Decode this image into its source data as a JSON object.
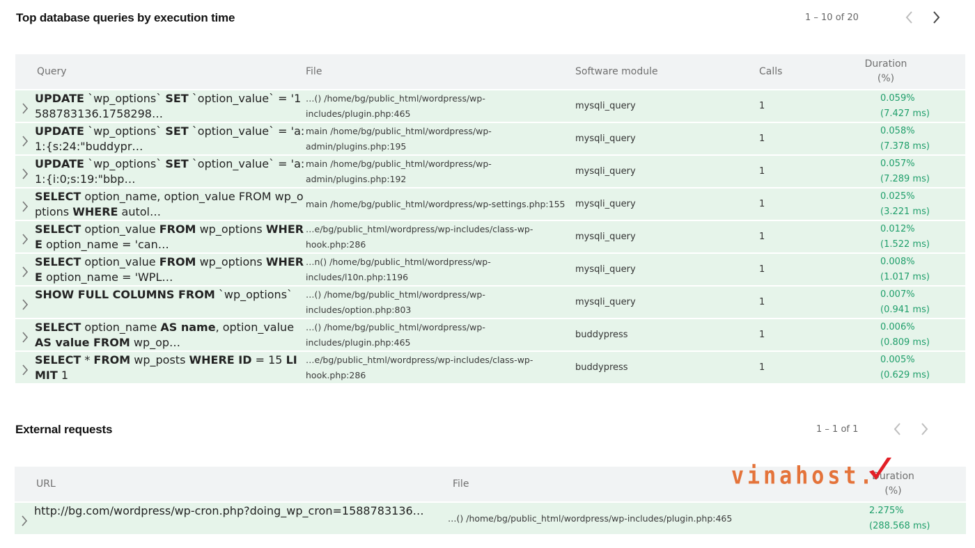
{
  "queries": {
    "title": "Top database queries by execution time",
    "pager": {
      "range": "1 – 10 of 20"
    },
    "columns": {
      "query": "Query",
      "file": "File",
      "module": "Software module",
      "calls": "Calls",
      "duration_1": "Duration",
      "duration_2": "(%)"
    },
    "rows": [
      {
        "query_html": "<b>UPDATE</b> `wp_options` <b>SET</b> `option_value` = '1588783136.1758298…",
        "file": "…() /home/bg/public_html/wordpress/wp-includes/plugin.php:465",
        "module": "mysqli_query",
        "calls": "1",
        "duration": "0.059% (7.427 ms)"
      },
      {
        "query_html": "<b>UPDATE</b> `wp_options` <b>SET</b> `option_value` = 'a:1:{s:24:\"buddypr…",
        "file": "main /home/bg/public_html/wordpress/wp-admin/plugins.php:195",
        "module": "mysqli_query",
        "calls": "1",
        "duration": "0.058% (7.378 ms)"
      },
      {
        "query_html": "<b>UPDATE</b> `wp_options` <b>SET</b> `option_value` = 'a:1:{i:0;s:19:\"bbp…",
        "file": "main /home/bg/public_html/wordpress/wp-admin/plugins.php:192",
        "module": "mysqli_query",
        "calls": "1",
        "duration": "0.057% (7.289 ms)"
      },
      {
        "query_html": "<b>SELECT</b> option_name, option_value FROM wp_options <b>WHERE</b> autol…",
        "file": "main /home/bg/public_html/wordpress/wp-settings.php:155",
        "module": "mysqli_query",
        "calls": "1",
        "duration": "0.025% (3.221 ms)"
      },
      {
        "query_html": "<b>SELECT</b> option_value <b>FROM</b> wp_options <b>WHERE</b> option_name = 'can…",
        "file": "…e/bg/public_html/wordpress/wp-includes/class-wp-hook.php:286",
        "module": "mysqli_query",
        "calls": "1",
        "duration": "0.012% (1.522 ms)"
      },
      {
        "query_html": "<b>SELECT</b> option_value <b>FROM</b> wp_options <b>WHERE</b> option_name = 'WPL…",
        "file": "…n() /home/bg/public_html/wordpress/wp-includes/l10n.php:1196",
        "module": "mysqli_query",
        "calls": "1",
        "duration": "0.008% (1.017 ms)"
      },
      {
        "query_html": "<b>SHOW FULL COLUMNS FROM</b> `wp_options`",
        "file": "…() /home/bg/public_html/wordpress/wp-includes/option.php:803",
        "module": "mysqli_query",
        "calls": "1",
        "duration": "0.007% (0.941 ms)"
      },
      {
        "query_html": "<b>SELECT</b> option_name <b>AS name</b>, option_value <b>AS value FROM</b> wp_op…",
        "file": "…() /home/bg/public_html/wordpress/wp-includes/plugin.php:465",
        "module": "buddypress",
        "calls": "1",
        "duration": "0.006% (0.809 ms)"
      },
      {
        "query_html": "<b>SELECT</b> * <b>FROM</b> wp_posts <b>WHERE ID</b> = 15 <b>LIMIT</b> 1",
        "file": "…e/bg/public_html/wordpress/wp-includes/class-wp-hook.php:286",
        "module": "buddypress",
        "calls": "1",
        "duration": "0.005% (0.629 ms)"
      }
    ]
  },
  "external": {
    "title": "External requests",
    "pager": {
      "range": "1 – 1 of 1"
    },
    "columns": {
      "url": "URL",
      "file": "File",
      "duration_1": "Duration",
      "duration_2": "(%)"
    },
    "watermark": "vinahost.",
    "rows": [
      {
        "url": "http://bg.com/wordpress/wp-cron.php?doing_wp_cron=1588783136…",
        "file": "…() /home/bg/public_html/wordpress/wp-includes/plugin.php:465",
        "duration": "2.275% (288.568 ms)"
      }
    ]
  },
  "icons": {
    "expand": "chevron-right-icon",
    "prev": "chevron-left-icon",
    "next": "chevron-right-icon"
  },
  "colors": {
    "row_bg": "#e6f4ea",
    "header_bg": "#f1f3f4",
    "duration_text": "#1e9e6a",
    "watermark": "#e4733a",
    "check": "#e21f26"
  }
}
